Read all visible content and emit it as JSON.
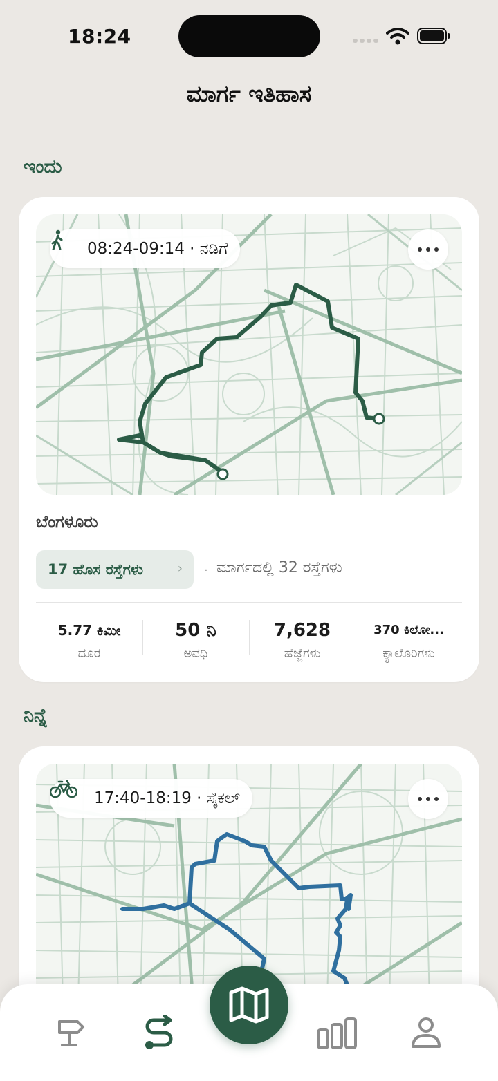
{
  "status_bar": {
    "time": "18:24"
  },
  "page_title": "ಮಾರ್ಗ ಇತಿಹಾಸ",
  "sections": [
    {
      "title": "ಇಂದು",
      "card": {
        "activity_icon": "walking-person-icon",
        "time_range": "08:24-09:14",
        "activity": "ನಡಿಗೆ",
        "chip_text": "08:24-09:14 · ನಡಿಗೆ",
        "route_color": "#2b5c46",
        "city": "ಬೆಂಗಳೂರು",
        "new_roads": "17 ಹೊಸ ರಸ್ತೆಗಳು",
        "roads_in_route": "ಮಾರ್ಗದಲ್ಲಿ 32 ರಸ್ತೆಗಳು",
        "stats": [
          {
            "value": "5.77 ಕಿಮೀ",
            "label": "ದೂರ"
          },
          {
            "value": "50 ನಿ",
            "label": "ಅವಧಿ"
          },
          {
            "value": "7,628",
            "label": "ಹೆಜ್ಜೆಗಳು"
          },
          {
            "value": "370 ಕಿಲೋ...",
            "label": "ಕ್ಯಾಲೊರಿಗಳು"
          }
        ]
      }
    },
    {
      "title": "ನಿನ್ನೆ",
      "card": {
        "activity_icon": "bicycle-icon",
        "time_range": "17:40-18:19",
        "activity": "ಸೈಕಲ್",
        "chip_text": "17:40-18:19 · ಸೈಕಲ್",
        "route_color": "#2f6f9f"
      }
    }
  ],
  "bottom_nav": [
    {
      "name": "explore",
      "icon": "signpost-icon",
      "active": false
    },
    {
      "name": "routes",
      "icon": "route-icon",
      "active": true
    },
    {
      "name": "map",
      "icon": "map-icon",
      "active": false,
      "primary": true
    },
    {
      "name": "stats",
      "icon": "bar-chart-icon",
      "active": false
    },
    {
      "name": "profile",
      "icon": "person-icon",
      "active": false
    }
  ],
  "colors": {
    "accent": "#2b5c46",
    "background": "#ebe8e4",
    "card": "#ffffff",
    "cycle_route": "#2f6f9f"
  }
}
